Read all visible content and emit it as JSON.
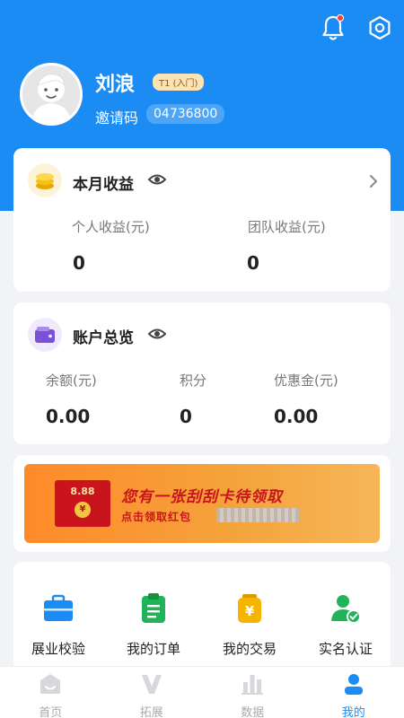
{
  "profile": {
    "name": "刘浪",
    "level": "T1 (入门)",
    "invite_label": "邀请码",
    "invite_code": "04736800"
  },
  "earnings": {
    "title": "本月收益",
    "personal_label": "个人收益(元)",
    "personal_value": "0",
    "team_label": "团队收益(元)",
    "team_value": "0"
  },
  "account": {
    "title": "账户总览",
    "balance_label": "余额(元)",
    "balance_value": "0.00",
    "points_label": "积分",
    "points_value": "0",
    "coupon_label": "优惠金(元)",
    "coupon_value": "0.00"
  },
  "banner": {
    "amount": "8.88",
    "coin": "¥",
    "title": "您有一张刮刮卡待领取",
    "subtitle": "点击领取红包"
  },
  "quick_actions": [
    {
      "label": "展业校验",
      "icon": "briefcase-icon",
      "color": "#1c8cf5"
    },
    {
      "label": "我的订单",
      "icon": "clipboard-icon",
      "color": "#1fb45a"
    },
    {
      "label": "我的交易",
      "icon": "yen-jar-icon",
      "color": "#f5b400"
    },
    {
      "label": "实名认证",
      "icon": "verified-user-icon",
      "color": "#1fb45a"
    }
  ],
  "tabs": [
    {
      "label": "首页",
      "icon": "home-icon"
    },
    {
      "label": "拓展",
      "icon": "expand-v-icon"
    },
    {
      "label": "数据",
      "icon": "bar-chart-icon"
    },
    {
      "label": "我的",
      "icon": "profile-icon",
      "active": true
    }
  ],
  "colors": {
    "brand": "#1c8cf5",
    "notification_dot": "#ff3b30",
    "banner": "#ff8a2a"
  }
}
